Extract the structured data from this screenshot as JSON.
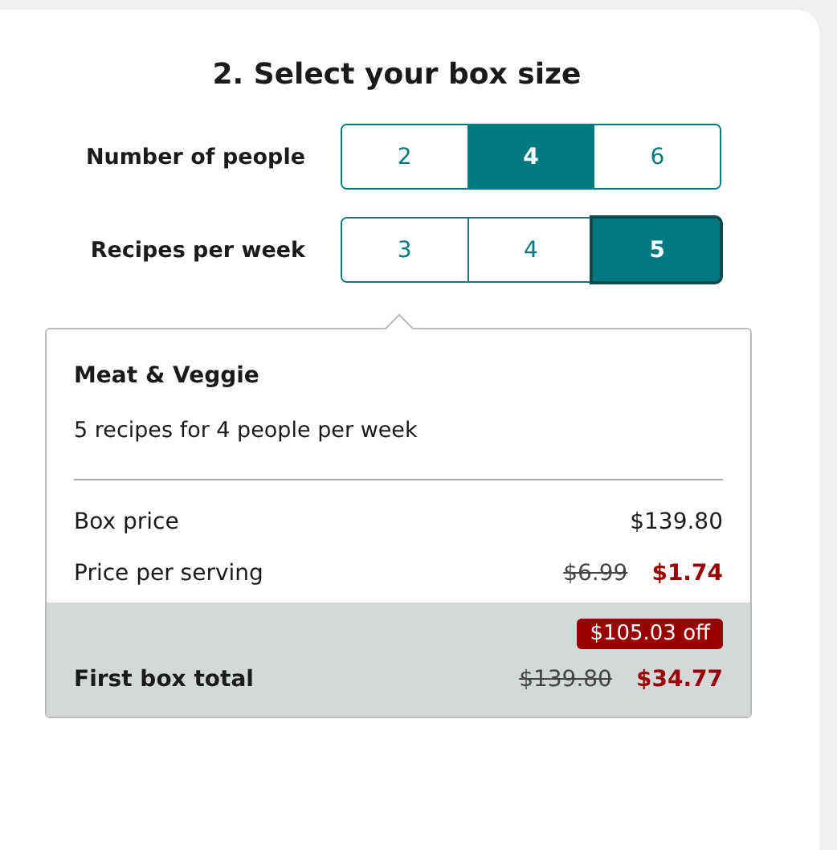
{
  "title": "2. Select your box size",
  "selectors": [
    {
      "label": "Number of people",
      "options": [
        {
          "label": "2",
          "selected": false
        },
        {
          "label": "4",
          "selected": true
        },
        {
          "label": "6",
          "selected": false
        }
      ]
    },
    {
      "label": "Recipes per week",
      "options": [
        {
          "label": "3",
          "selected": false
        },
        {
          "label": "4",
          "selected": false
        },
        {
          "label": "5",
          "selected": true
        }
      ]
    }
  ],
  "summary": {
    "plan": "Meat & Veggie",
    "description": "5 recipes for 4 people per week",
    "rows": [
      {
        "label": "Box price",
        "value": "$139.80"
      },
      {
        "label": "Price per serving",
        "original": "$6.99",
        "value": "$1.74"
      }
    ],
    "total": {
      "badge": "$105.03 off",
      "label": "First box total",
      "original": "$139.80",
      "value": "$34.77"
    }
  }
}
